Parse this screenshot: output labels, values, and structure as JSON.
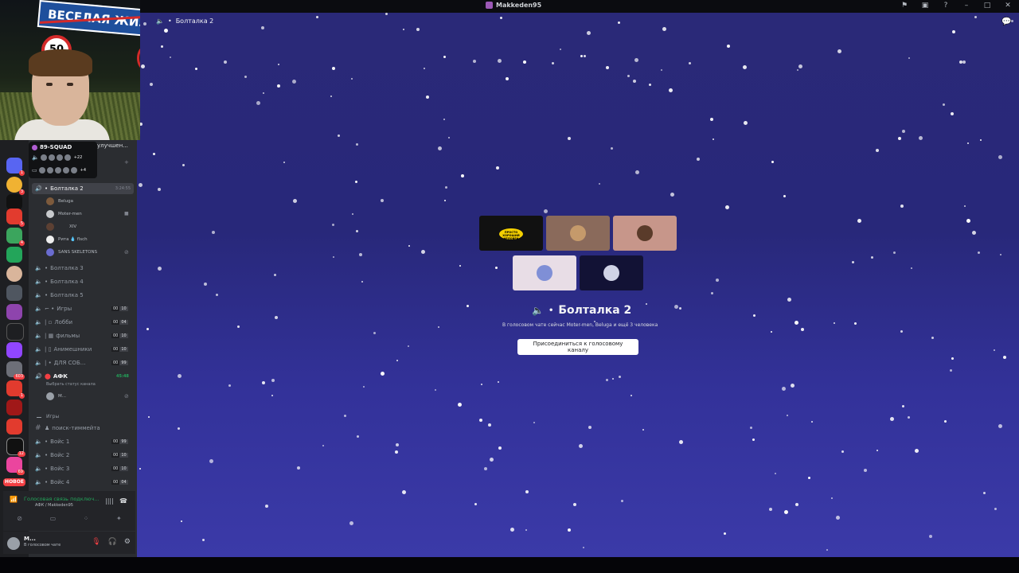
{
  "window": {
    "title": "Makkeden95"
  },
  "titlebar_icons": [
    "inbox-icon",
    "monitor-icon",
    "help-icon",
    "minimize-icon",
    "maximize-icon",
    "close-icon"
  ],
  "webcam": {
    "sign_text": "ВЕСЕЛАЯ ЖИЗ",
    "limit_sign": "50"
  },
  "server": {
    "name": "улучшен..."
  },
  "squad": {
    "name": "89-SQUAD",
    "row1_count": "+22",
    "row2_count": "+4"
  },
  "header": {
    "channel": "Болталка 2"
  },
  "guild_badges": [
    "1",
    "3",
    "5",
    "4",
    "603",
    "1",
    "12",
    "69"
  ],
  "new_badge": "НОВОЕ",
  "channels": {
    "active": {
      "name": "Болталка 2",
      "timer": "3:24:55"
    },
    "members": [
      "Beluga",
      "Moter-men",
      "XIV",
      "Рита 💧 flsch",
      "SANS SKELETONS"
    ],
    "list": [
      {
        "name": "Болталка 3"
      },
      {
        "name": "Болталка 4"
      },
      {
        "name": "Болталка 5"
      },
      {
        "name": "Игры",
        "count": "00",
        "limit": "10"
      },
      {
        "name": "Лобби",
        "count": "00",
        "limit": "04"
      },
      {
        "name": "фильмы",
        "count": "00",
        "limit": "10"
      },
      {
        "name": "Анимешники",
        "count": "00",
        "limit": "10"
      },
      {
        "name": "ДЛЯ СОБ...",
        "count": "00",
        "limit": "99"
      }
    ],
    "afk": {
      "name": "АФК",
      "timer": "45:48",
      "status": "Выбрать статус канала",
      "member": "M..."
    },
    "category": "Игры",
    "text_channel": "поиск-тиммейта",
    "voice": [
      {
        "name": "Войс 1",
        "count": "00",
        "limit": "99"
      },
      {
        "name": "Войс 2",
        "count": "00",
        "limit": "10"
      },
      {
        "name": "Войс 3",
        "count": "00",
        "limit": "10"
      },
      {
        "name": "Войс 4",
        "count": "00",
        "limit": "04"
      }
    ]
  },
  "voice_panel": {
    "status": "Голосовая связь подключ...",
    "location": "АФК / Makkeden95"
  },
  "user_panel": {
    "name": "M...",
    "status": "В голосовом чате"
  },
  "main": {
    "title": "Болталка 2",
    "subtitle": "В голосовом чате сейчас Moter-men, Beluga и ещё 3 человека",
    "join_button": "Присоединиться к голосовому каналу",
    "tile_text": "ПРОСТО ХОРОШИЙ ЧЕЛОВЕК"
  },
  "colors": {
    "accent_green": "#23a55a",
    "danger": "#f23f43",
    "bg_stage": "#2a2978"
  }
}
